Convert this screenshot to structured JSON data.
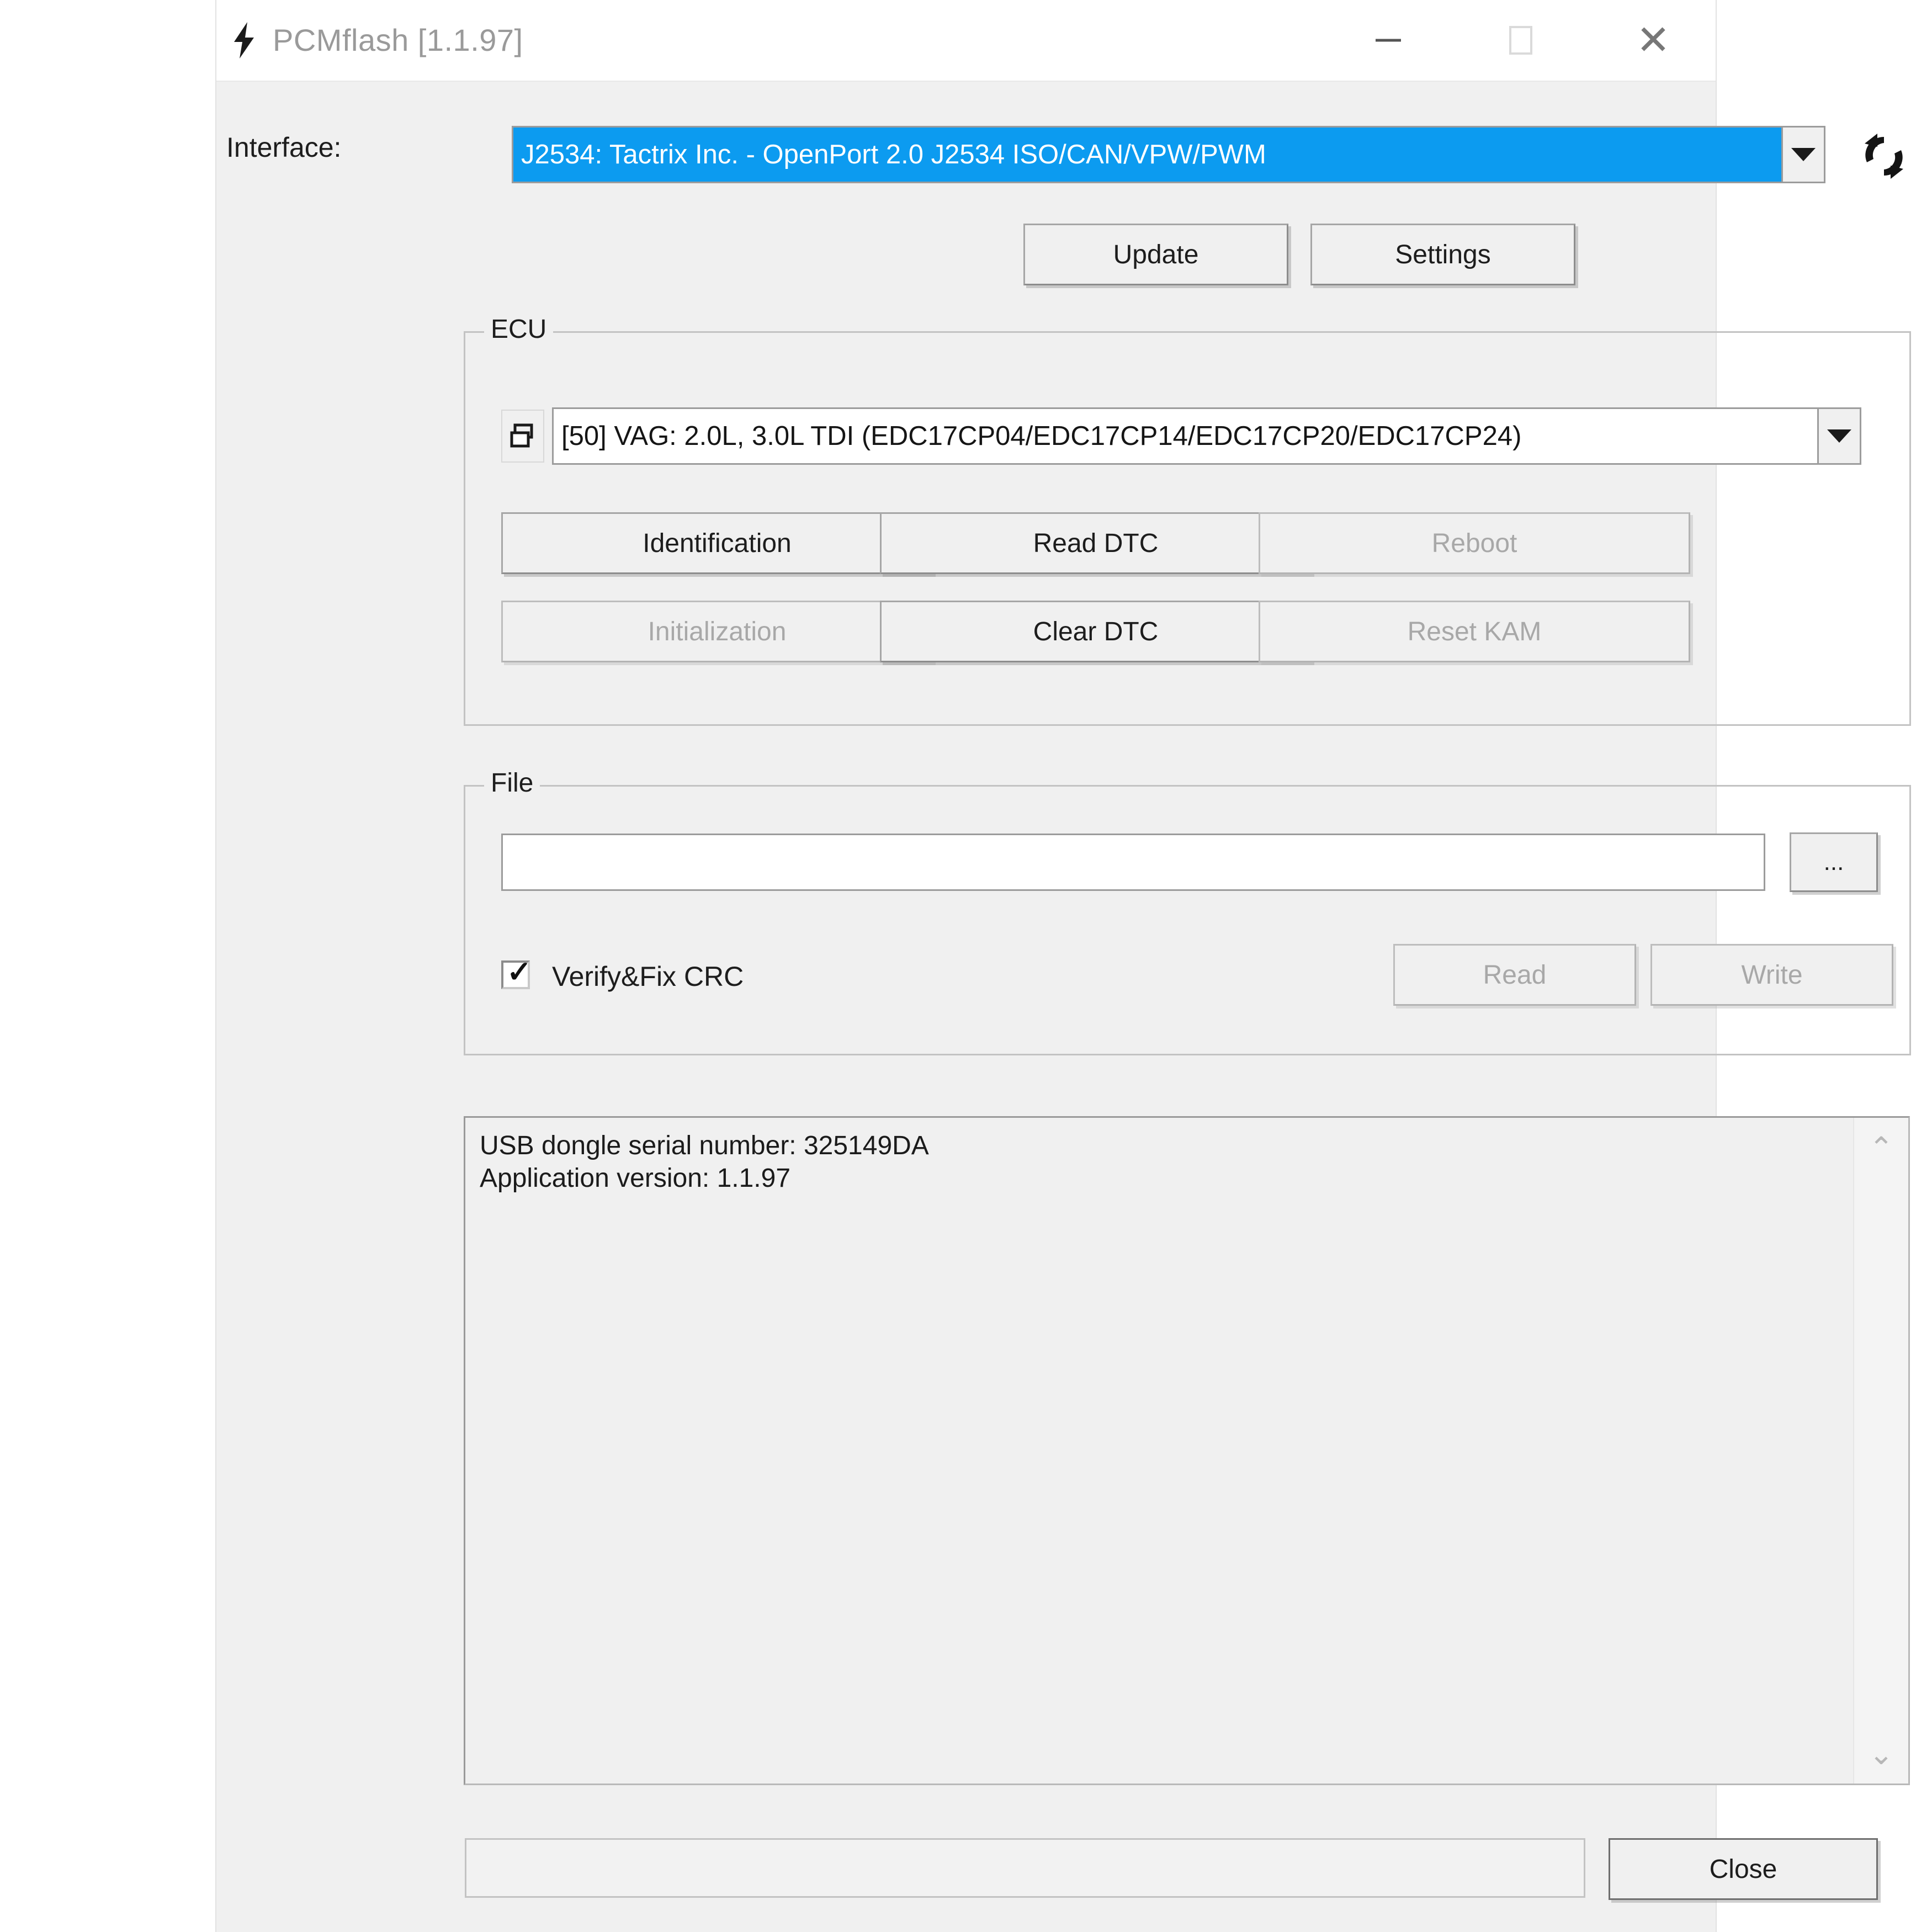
{
  "window": {
    "title": "PCMflash [1.1.97]",
    "app_icon": "lightning-bolt-icon",
    "minimize_label": "—",
    "maximize_label": "",
    "close_label": "✕"
  },
  "interface": {
    "label": "Interface:",
    "selected_value": "J2534: Tactrix Inc. - OpenPort 2.0 J2534 ISO/CAN/VPW/PWM",
    "refresh_icon": "refresh-icon",
    "dropdown_icon": "chevron-down-icon"
  },
  "toolbar": {
    "update_label": "Update",
    "settings_label": "Settings"
  },
  "ecu": {
    "legend": "ECU",
    "selected_value": "[50] VAG: 2.0L, 3.0L TDI (EDC17CP04/EDC17CP14/EDC17CP20/EDC17CP24)",
    "list_icon": "ecu-list-icon",
    "dropdown_icon": "chevron-down-icon",
    "buttons": [
      {
        "label": "Identification",
        "enabled": true
      },
      {
        "label": "Read DTC",
        "enabled": true
      },
      {
        "label": "Reboot",
        "enabled": false
      },
      {
        "label": "Initialization",
        "enabled": false
      },
      {
        "label": "Clear DTC",
        "enabled": true
      },
      {
        "label": "Reset KAM",
        "enabled": false
      }
    ]
  },
  "file": {
    "legend": "File",
    "path_value": "",
    "path_placeholder": "",
    "browse_label": "...",
    "verify_crc_label": "Verify&Fix CRC",
    "verify_crc_checked": true,
    "read_label": "Read",
    "read_enabled": false,
    "write_label": "Write",
    "write_enabled": false
  },
  "log": {
    "lines": [
      "USB dongle serial number: 325149DA",
      "Application version: 1.1.97"
    ],
    "text": "USB dongle serial number: 325149DA\nApplication version: 1.1.97",
    "scroll_up_icon": "chevron-up-icon",
    "scroll_down_icon": "chevron-down-icon"
  },
  "footer": {
    "progress_value": "",
    "close_label": "Close"
  },
  "colors": {
    "window_bg": "#f0f0f0",
    "titlebar_bg": "#ffffff",
    "selection_blue": "#0c9bf0",
    "text": "#1d1d1d",
    "disabled_text": "#a8a8a8",
    "border": "#9c9c9c"
  }
}
